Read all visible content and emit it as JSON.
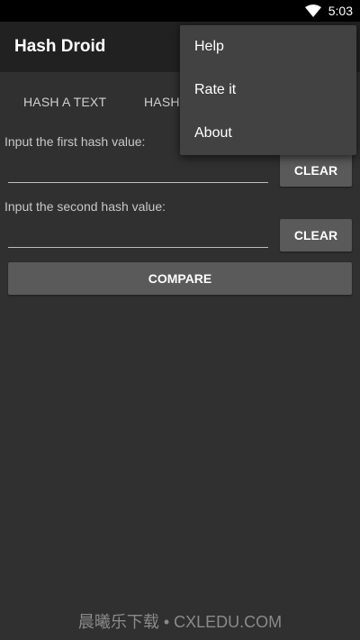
{
  "status_bar": {
    "time": "5:03",
    "wifi_icon": "wifi-icon"
  },
  "app_bar": {
    "title": "Hash Droid"
  },
  "tabs": [
    {
      "label": "HASH A TEXT"
    },
    {
      "label": "HASH"
    }
  ],
  "first_hash": {
    "label": "Input the first hash value:",
    "value": "",
    "clear_label": "CLEAR"
  },
  "second_hash": {
    "label": "Input the second hash value:",
    "value": "",
    "clear_label": "CLEAR"
  },
  "compare": {
    "label": "COMPARE"
  },
  "menu": {
    "items": [
      {
        "label": "Help"
      },
      {
        "label": "Rate it"
      },
      {
        "label": "About"
      }
    ]
  },
  "watermark": {
    "text": "晨曦乐下载 • CXLEDU.COM"
  },
  "colors": {
    "background": "#303030",
    "app_bar": "#212121",
    "menu": "#424242",
    "button": "#5a5a5a"
  }
}
